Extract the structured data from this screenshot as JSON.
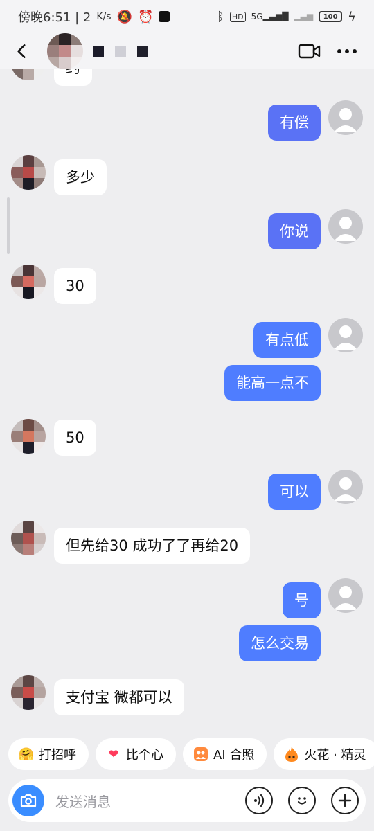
{
  "status_bar": {
    "time": "傍晚6:51 | 2",
    "speed": "K/s",
    "network": "5G",
    "battery": "100"
  },
  "header": {
    "back_label": "<"
  },
  "messages": [
    {
      "side": "in",
      "text": "约",
      "top": 0
    },
    {
      "side": "out",
      "text": "有偿"
    },
    {
      "side": "in",
      "text": "多少"
    },
    {
      "side": "out",
      "text": "你说"
    },
    {
      "side": "in",
      "text": "30"
    },
    {
      "side": "out",
      "text": "有点低"
    },
    {
      "side": "out",
      "text": "能高一点不"
    },
    {
      "side": "in",
      "text": "50"
    },
    {
      "side": "out",
      "text": "可以"
    },
    {
      "side": "in",
      "text": "但先给30 成功了了再给20"
    },
    {
      "side": "out",
      "text": "号"
    },
    {
      "side": "out",
      "text": "怎么交易"
    },
    {
      "side": "in",
      "text": "支付宝 微都可以"
    }
  ],
  "quick_replies": [
    {
      "icon": "wave-hand-icon",
      "label": "打招呼"
    },
    {
      "icon": "heart-icon",
      "label": "比个心"
    },
    {
      "icon": "ai-photo-icon",
      "label": "AI 合照"
    },
    {
      "icon": "flame-icon",
      "label": "火花 · 精灵"
    }
  ],
  "input": {
    "placeholder": "发送消息"
  },
  "colors": {
    "bubble_out": "#4f7dff",
    "bubble_out_alt": "#5a72f5",
    "bubble_in": "#ffffff",
    "background": "#eeeef0",
    "camera": "#3a8dff"
  }
}
